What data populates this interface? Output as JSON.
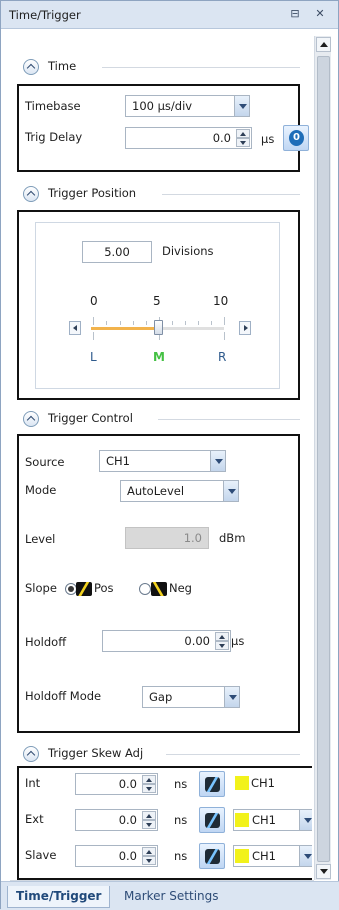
{
  "window": {
    "title": "Time/Trigger",
    "buttons": {
      "pin": "⊟",
      "close": "✕"
    }
  },
  "time": {
    "header": "Time",
    "timebase_label": "Timebase",
    "timebase_value": "100  µs/div",
    "trig_delay_label": "Trig Delay",
    "trig_delay_value": "0.0",
    "trig_delay_unit": "µs",
    "zero_button": "0"
  },
  "trigger_position": {
    "header": "Trigger Position",
    "divisions_value": "5.00",
    "divisions_label": "Divisions",
    "scale": [
      "0",
      "5",
      "10"
    ],
    "positions": [
      "L",
      "M",
      "R"
    ],
    "slider_value": 5,
    "slider_min": 0,
    "slider_max": 10
  },
  "trigger_control": {
    "header": "Trigger Control",
    "source_label": "Source",
    "source_value": "CH1",
    "mode_label": "Mode",
    "mode_value": "AutoLevel",
    "level_label": "Level",
    "level_value": "1.0",
    "level_unit": "dBm",
    "slope_label": "Slope",
    "slope_pos_label": "Pos",
    "slope_neg_label": "Neg",
    "slope_selected": "Pos",
    "holdoff_label": "Holdoff",
    "holdoff_value": "0.00",
    "holdoff_unit": "µs",
    "holdoff_mode_label": "Holdoff Mode",
    "holdoff_mode_value": "Gap"
  },
  "trigger_skew": {
    "header": "Trigger Skew Adj",
    "rows": [
      {
        "label": "Int",
        "value": "0.0",
        "unit": "ns",
        "channel": "CH1"
      },
      {
        "label": "Ext",
        "value": "0.0",
        "unit": "ns",
        "channel": "CH1"
      },
      {
        "label": "Slave",
        "value": "0.0",
        "unit": "ns",
        "channel": "CH1"
      }
    ]
  },
  "tabs": [
    {
      "label": "Time/Trigger",
      "active": true
    },
    {
      "label": "Marker Settings",
      "active": false
    }
  ],
  "colors": {
    "accent": "#1e6db8",
    "channel_swatch": "#f2f21b",
    "slope_icon": "#f3d21f",
    "slider_fill": "#f2b34c",
    "position_mid": "#44c043"
  }
}
